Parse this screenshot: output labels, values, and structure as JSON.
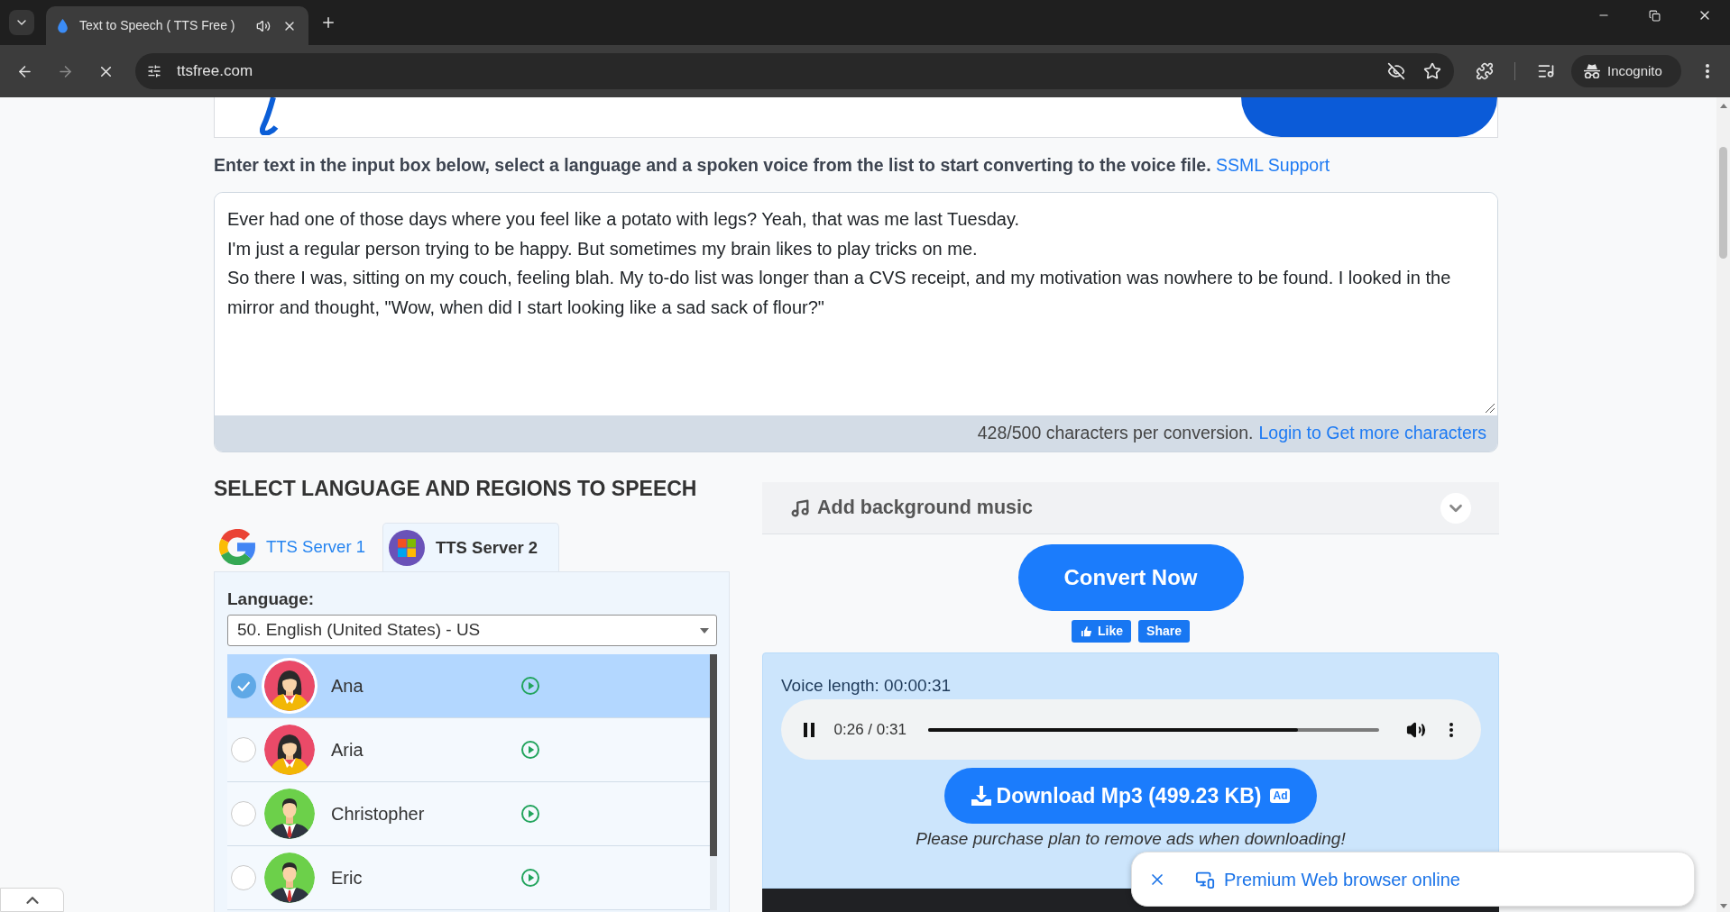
{
  "browser": {
    "tabs": [
      {
        "title": "Text to Speech ( TTS Free )",
        "selected": true,
        "audio": true
      }
    ],
    "loading": true,
    "url": "ttsfree.com",
    "profile": "Incognito"
  },
  "instruction": {
    "text": "Enter text in the input box below, select a language and a spoken voice from the list to start converting to the voice file.",
    "link": "SSML Support"
  },
  "text_input": {
    "lines": [
      "Ever had one of those days where you feel like a potato with legs? Yeah, that was me last Tuesday.",
      "I'm just a regular person trying to be happy. But sometimes my brain likes to play tricks on me.",
      "So there I was, sitting on my couch, feeling blah. My to-do list was longer than a CVS receipt, and my motivation was nowhere to be found. I looked in the",
      "mirror and thought, \"Wow, when did I start looking like a sad sack of flour?\""
    ],
    "counter": "428/500 characters per conversion.",
    "more_link": "Login to Get more characters"
  },
  "voice_section": {
    "heading": "SELECT LANGUAGE AND REGIONS TO SPEECH",
    "servers": [
      {
        "label": "TTS Server 1",
        "kind": "google",
        "selected": false
      },
      {
        "label": "TTS Server 2",
        "kind": "microsoft",
        "selected": true
      }
    ],
    "language_label": "Language:",
    "language": "50. English (United States) - US",
    "voices": [
      {
        "name": "Ana",
        "kind": "female",
        "selected": true
      },
      {
        "name": "Aria",
        "kind": "female",
        "selected": false
      },
      {
        "name": "Christopher",
        "kind": "male",
        "selected": false
      },
      {
        "name": "Eric",
        "kind": "male",
        "selected": false
      }
    ]
  },
  "music": {
    "label": "Add background music",
    "expanded": false
  },
  "convert_button": "Convert Now",
  "social": [
    {
      "label": "Like",
      "kind": "like"
    },
    {
      "label": "Share",
      "kind": "share"
    }
  ],
  "result": {
    "voice_length": "Voice length: 00:00:31",
    "player": {
      "time": "0:26 / 0:31",
      "playing": true,
      "level": 0.82
    },
    "download": {
      "label": "Download Mp3 (499.23 KB)",
      "badge": "Ad"
    },
    "notice": "Please purchase plan to remove ads when downloading!"
  },
  "popup": {
    "text": "Premium Web browser online"
  }
}
